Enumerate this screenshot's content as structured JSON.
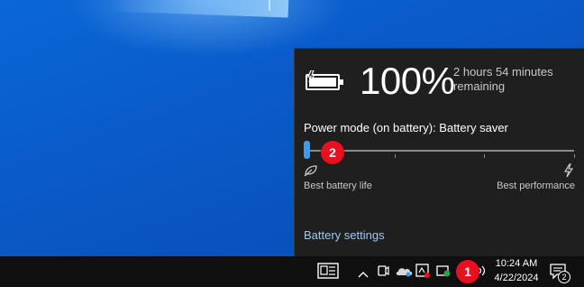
{
  "battery": {
    "percent": "100%",
    "remaining": "2 hours 54 minutes remaining"
  },
  "power_mode": {
    "label": "Power mode (on battery): Battery saver",
    "level": 0,
    "left_label": "Best battery life",
    "right_label": "Best performance"
  },
  "links": {
    "battery_settings": "Battery settings"
  },
  "callouts": {
    "one": "1",
    "two": "2"
  },
  "taskbar": {
    "time": "10:24 AM",
    "date": "4/22/2024",
    "notifications_count": "2",
    "icons": [
      "news-icon",
      "chevron-up-icon",
      "meet-now-icon",
      "onedrive-icon",
      "app-tray-icon",
      "security-icon",
      "battery-icon",
      "volume-icon",
      "action-center-icon"
    ]
  },
  "colors": {
    "accent": "#3a9bf0",
    "flyout_bg": "#1f1f1f",
    "badge": "#e8101e",
    "link": "#9fc6f0"
  }
}
